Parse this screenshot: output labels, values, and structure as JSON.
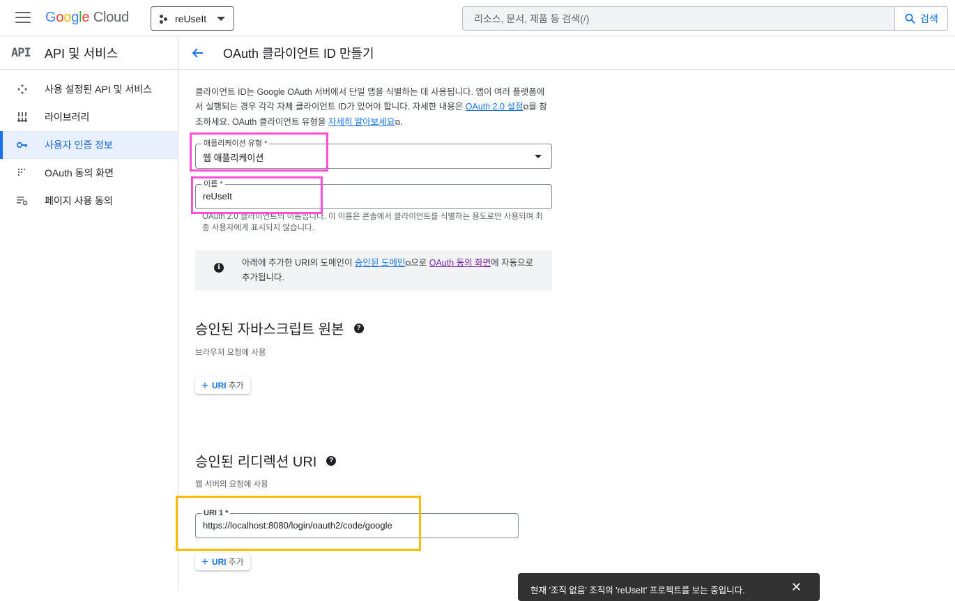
{
  "topbar": {
    "logo_parts": [
      "G",
      "o",
      "o",
      "g",
      "l",
      "e"
    ],
    "logo_cloud": "Cloud",
    "project_name": "reUseIt",
    "search_placeholder": "리소스, 문서, 제품 등 검색(/)",
    "search_button": "검색"
  },
  "sidebar": {
    "badge": "API",
    "title": "API 및 서비스",
    "items": [
      {
        "label": "사용 설정된 API 및 서비스",
        "icon": "diamond-move-icon",
        "active": false
      },
      {
        "label": "라이브러리",
        "icon": "library-icon",
        "active": false
      },
      {
        "label": "사용자 인증 정보",
        "icon": "key-icon",
        "active": true
      },
      {
        "label": "OAuth 동의 화면",
        "icon": "oauth-dots-icon",
        "active": false
      },
      {
        "label": "페이지 사용 동의",
        "icon": "settings-list-icon",
        "active": false
      }
    ]
  },
  "header": {
    "title": "OAuth 클라이언트 ID 만들기"
  },
  "content": {
    "desc_1": "클라이언트 ID는 Google OAuth 서버에서 단일 앱을 식별하는 데 사용됩니다. 앱이 여러 플랫폼에서 실행되는 경우 각각 자체 클라이언트 ID가 있어야 합니다. 자세한 내용은 ",
    "desc_link1": "OAuth 2.0 설정",
    "desc_2": "을 참조하세요. OAuth 클라이언트 유형을 ",
    "desc_link2": "자세히 알아보세요",
    "desc_3": ".",
    "app_type_label": "애플리케이션 유형 *",
    "app_type_value": "웹 애플리케이션",
    "name_label": "이름 *",
    "name_value": "reUseIt",
    "name_hint": "OAuth 2.0 클라이언트의 이름입니다. 이 이름은 콘솔에서 클라이언트를 식별하는 용도로만 사용되며 최종 사용자에게 표시되지 않습니다.",
    "info_1": "아래에 추가한 URI의 도메인이 ",
    "info_link1": "승인된 도메인",
    "info_2": "으로 ",
    "info_link2": "OAuth 동의 화면",
    "info_3": "에 자동으로 추가됩니다.",
    "js_title": "승인된 자바스크립트 원본",
    "js_sub": "브라우저 요청에 사용",
    "add_uri_label": "URI",
    "add_uri_suffix": "추가",
    "redirect_title": "승인된 리디렉션 URI",
    "redirect_sub": "웹 서버의 요청에 사용",
    "uri1_label": "URI 1 *",
    "uri1_value": "https://localhost:8080/login/oauth2/code/google"
  },
  "snackbar": {
    "text": "현재 '조직 없음' 조직의 'reUseIt' 프로젝트를 보는 중입니다."
  },
  "colors": {
    "accent": "#1a73e8",
    "highlight_pink": "#ff4fd8",
    "highlight_gold": "#fbbc04"
  }
}
